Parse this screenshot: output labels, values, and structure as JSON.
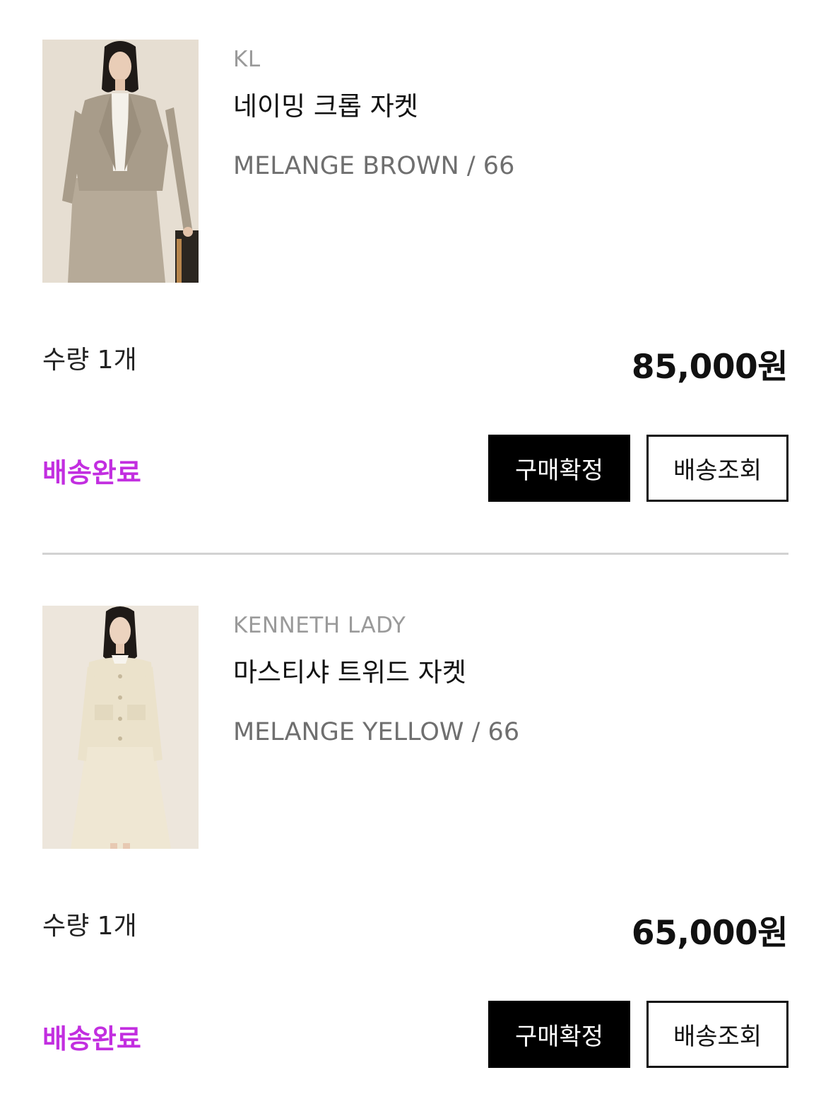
{
  "orders": [
    {
      "brand": "KL",
      "product_name": "네이밍 크롭 자켓",
      "option": "MELANGE BROWN / 66",
      "quantity": "수량 1개",
      "price": "85,000원",
      "status": "배송완료",
      "confirm_label": "구매확정",
      "track_label": "배송조회"
    },
    {
      "brand": "KENNETH LADY",
      "product_name": "마스티샤 트위드 자켓",
      "option": "MELANGE YELLOW / 66",
      "quantity": "수량 1개",
      "price": "65,000원",
      "status": "배송완료",
      "confirm_label": "구매확정",
      "track_label": "배송조회"
    }
  ],
  "colors": {
    "status": "#c22ee0",
    "primary_button_bg": "#000000",
    "brand_text": "#9a9a9a",
    "option_text": "#6f6f6f",
    "divider": "#d2d2d2"
  }
}
